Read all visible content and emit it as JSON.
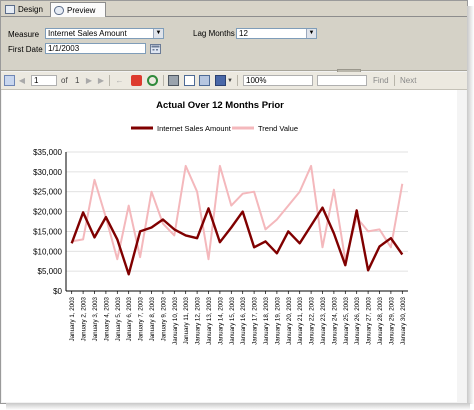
{
  "tabs": {
    "design": "Design",
    "preview": "Preview"
  },
  "params": {
    "measure_label": "Measure",
    "measure_value": "Internet Sales Amount",
    "lag_label": "Lag Months",
    "lag_value": "12",
    "date_label": "First Date",
    "date_value": "1/1/2003"
  },
  "toolbar": {
    "page_value": "1",
    "of_label": "of",
    "total_pages": "1",
    "zoom_value": "100%",
    "find_label": "Find",
    "next_label": "Next"
  },
  "colors": {
    "sales": "#800000",
    "trend": "#f4b8bc",
    "grid": "#d8d8d8"
  },
  "chart_data": {
    "type": "line",
    "title": "Actual Over 12 Months Prior",
    "ylim": [
      0,
      35000
    ],
    "yticks": [
      "$0",
      "$5,000",
      "$10,000",
      "$15,000",
      "$20,000",
      "$25,000",
      "$30,000",
      "$35,000"
    ],
    "x": [
      "January 1, 2003",
      "January 2, 2003",
      "January 3, 2003",
      "January 4, 2003",
      "January 5, 2003",
      "January 6, 2003",
      "January 7, 2003",
      "January 8, 2003",
      "January 9, 2003",
      "January 10, 2003",
      "January 11, 2003",
      "January 12, 2003",
      "January 13, 2003",
      "January 14, 2003",
      "January 15, 2003",
      "January 16, 2003",
      "January 17, 2003",
      "January 18, 2003",
      "January 19, 2003",
      "January 20, 2003",
      "January 21, 2003",
      "January 22, 2003",
      "January 23, 2003",
      "January 24, 2003",
      "January 25, 2003",
      "January 26, 2003",
      "January 27, 2003",
      "January 28, 2003",
      "January 29, 2003",
      "January 30, 2003"
    ],
    "series": [
      {
        "name": "Internet Sales Amount",
        "values": [
          12000,
          19800,
          13500,
          18600,
          13000,
          4200,
          15000,
          16000,
          18000,
          15500,
          14000,
          13300,
          20800,
          12300,
          16000,
          20000,
          11000,
          12500,
          9500,
          15000,
          12000,
          16500,
          21000,
          14500,
          6500,
          20300,
          5200,
          11200,
          13300,
          9200
        ]
      },
      {
        "name": "Trend Value",
        "values": [
          12500,
          13000,
          28000,
          18500,
          8000,
          21500,
          8500,
          25000,
          17000,
          14000,
          31500,
          25000,
          8000,
          31500,
          21500,
          24500,
          25000,
          15500,
          18000,
          21500,
          25000,
          31500,
          11000,
          25500,
          7800,
          18500,
          15000,
          15500,
          11000,
          27000
        ]
      }
    ]
  }
}
